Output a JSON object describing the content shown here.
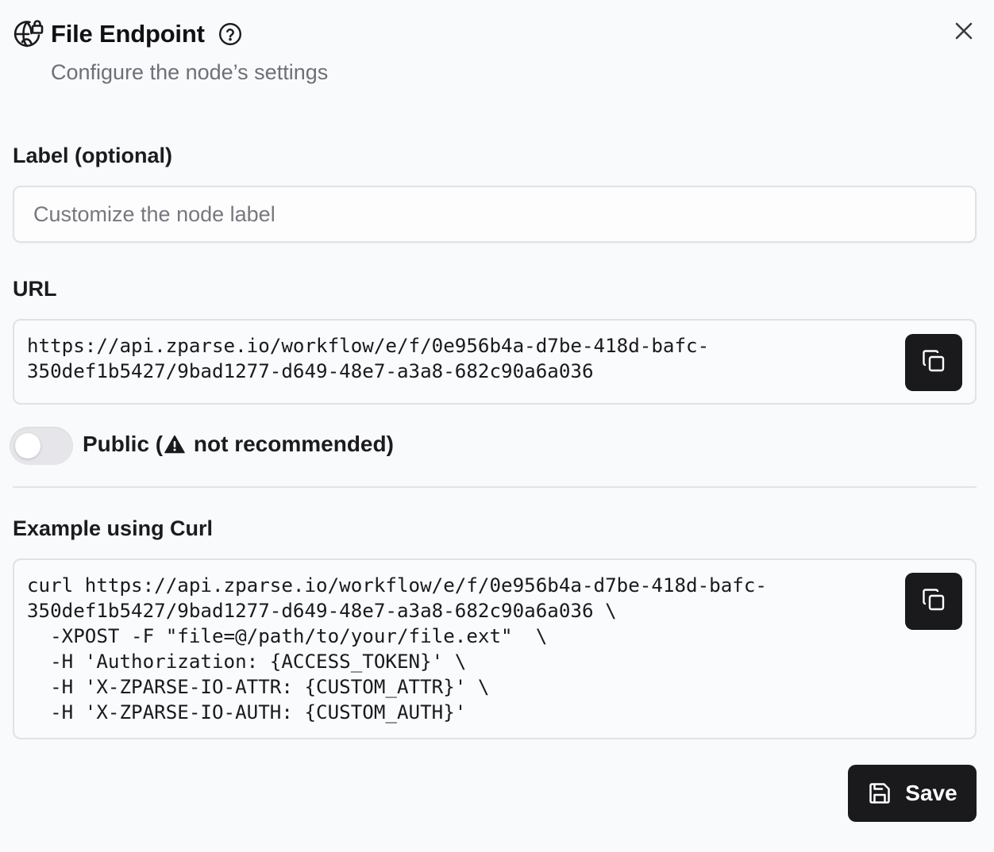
{
  "header": {
    "title": "File Endpoint",
    "subtitle": "Configure the node’s settings",
    "icon": "globe-lock-icon",
    "help_icon": "help-circle-icon",
    "close_icon": "close-icon"
  },
  "label_field": {
    "label": "Label (optional)",
    "value": "",
    "placeholder": "Customize the node label"
  },
  "url_field": {
    "label": "URL",
    "value": "https://api.zparse.io/workflow/e/f/0e956b4a-d7be-418d-bafc-\n350def1b5427/9bad1277-d649-48e7-a3a8-682c90a6a036",
    "copy_icon": "copy-icon"
  },
  "public_toggle": {
    "checked": false,
    "label_prefix": "Public (",
    "warning_icon": "warning-triangle-icon",
    "label_suffix": " not recommended)"
  },
  "curl_example": {
    "label": "Example using Curl",
    "code": "curl https://api.zparse.io/workflow/e/f/0e956b4a-d7be-418d-bafc-\n350def1b5427/9bad1277-d649-48e7-a3a8-682c90a6a036 \\\n  -XPOST -F \"file=@/path/to/your/file.ext\"  \\\n  -H 'Authorization: {ACCESS_TOKEN}' \\\n  -H 'X-ZPARSE-IO-ATTR: {CUSTOM_ATTR}' \\\n  -H 'X-ZPARSE-IO-AUTH: {CUSTOM_AUTH}'",
    "copy_icon": "copy-icon"
  },
  "footer": {
    "save_label": "Save",
    "save_icon": "save-icon"
  },
  "colors": {
    "background": "#f9fafc",
    "button_dark": "#1a1a1d",
    "border": "#e1e1e6",
    "muted_text": "#6f6f76"
  }
}
